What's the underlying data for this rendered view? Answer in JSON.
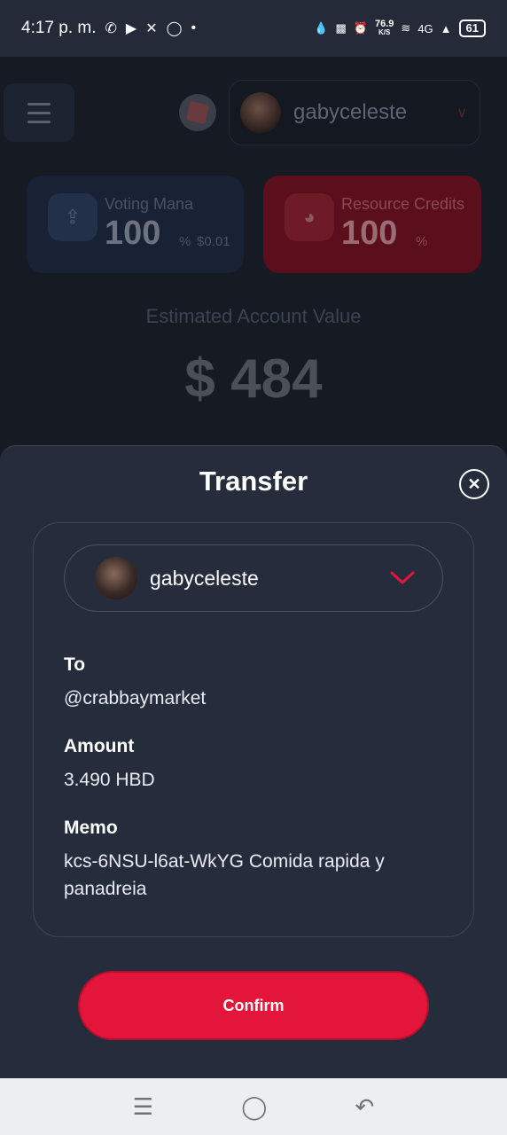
{
  "status_bar": {
    "time": "4:17 p. m.",
    "icons_left": [
      "whatsapp-icon",
      "youtube-icon",
      "x-icon",
      "instagram-icon",
      "dot-icon"
    ],
    "speed_value": "76.9",
    "speed_unit": "K/S",
    "network": "4G",
    "battery": "61"
  },
  "header": {
    "username": "gabyceleste"
  },
  "cards": {
    "voting": {
      "label": "Voting Mana",
      "value": "100",
      "unit": "%",
      "extra": "$0.01"
    },
    "resource": {
      "label": "Resource Credits",
      "value": "100",
      "unit": "%"
    }
  },
  "estimate": {
    "label": "Estimated Account Value",
    "value": "$ 484"
  },
  "transfer": {
    "title": "Transfer",
    "account": "gabyceleste",
    "to_label": "To",
    "to_value": "@crabbaymarket",
    "amount_label": "Amount",
    "amount_value": "3.490 HBD",
    "memo_label": "Memo",
    "memo_value": "kcs-6NSU-l6at-WkYG Comida rapida y panadreia",
    "confirm_label": "Confirm"
  },
  "colors": {
    "accent": "#e3153a",
    "sheet": "#252d3d"
  }
}
